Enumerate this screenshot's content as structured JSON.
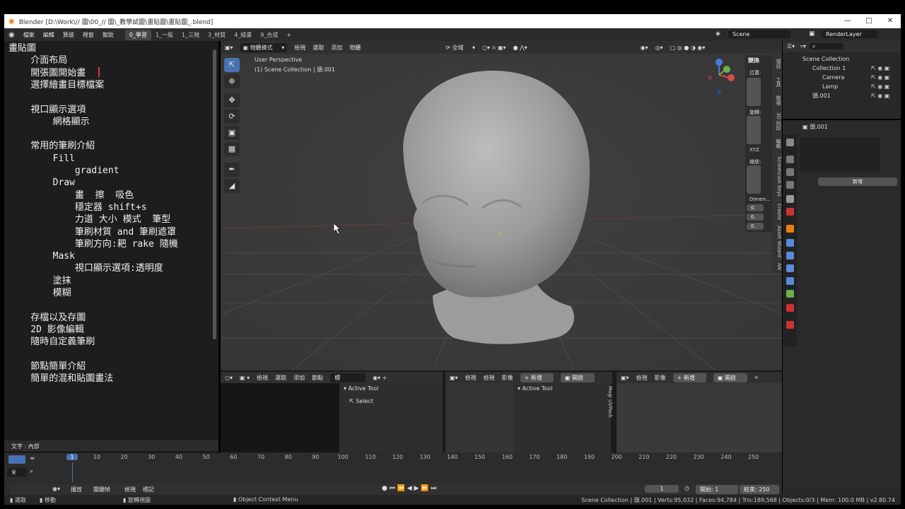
{
  "window": {
    "title": "Blender [D:\\Work\\// 圖\\00_// 圖\\_教學試圖\\畫貼圖\\畫貼圖_.blend]",
    "controls": [
      "—",
      "□",
      "✕"
    ]
  },
  "menubar": {
    "items": [
      "檔案",
      "編輯",
      "算繪",
      "視窗",
      "幫助"
    ],
    "workspaces": [
      "0_學習",
      "1_一般",
      "1_三視",
      "3_材質",
      "4_繪畫",
      "9_合成"
    ],
    "add": "+",
    "scene": "Scene",
    "renderlayer": "RenderLayer"
  },
  "textpanel": {
    "status": "文字 : 內部",
    "lines": [
      "畫貼圖",
      "    介面布局",
      "    開張圖開始畫",
      "    選擇繪畫目標檔案",
      "",
      "    視口顯示選項",
      "        網格顯示",
      "",
      "    常用的筆刷介紹",
      "        Fill",
      "            gradient",
      "        Draw",
      "            畫  擦  吸色",
      "            穩定器 shift+s",
      "            力道 大小 模式  筆型",
      "            筆刷材質 and 筆刷遮罩",
      "            筆刷方向:耙 rake 隨機",
      "        Mask",
      "            視口顯示選項:透明度",
      "        塗抹",
      "        模糊",
      "",
      "    存檔以及存圖",
      "    2D 影像編輯",
      "    隨時自定義筆刷",
      "",
      "    節點簡單介紹",
      "    簡單的混和貼圖畫法"
    ]
  },
  "viewport": {
    "mode": "物體模式",
    "menu": [
      "檢視",
      "選取",
      "添加",
      "物體"
    ],
    "orient": "全域",
    "info1": "User Perspective",
    "info2": "(1) Scene Collection | 頭.001",
    "npanel_title": "變換",
    "npanel_labels": [
      "位置:",
      "旋轉:",
      "XYZ",
      "縮放:",
      "Dimen..."
    ],
    "dim_values": [
      "0.",
      "0.",
      "0."
    ],
    "tabs": [
      "項目",
      "工具",
      "檢視",
      "3D 列印",
      "編輯",
      "Screencast Keys",
      "Create",
      "Asset Wizard",
      "AN"
    ]
  },
  "outliner": {
    "rows": [
      "Scene Collection",
      "Collection 1",
      "Camera",
      "Lamp",
      "頭.001"
    ]
  },
  "properties": {
    "object": "頭.001",
    "new": "新增"
  },
  "bottom": {
    "left_menu": [
      "檢視",
      "選取",
      "添加",
      "節點"
    ],
    "left_field": "標",
    "mid_menu": [
      "檢視",
      "檢視",
      "影像"
    ],
    "new": "新增",
    "open": "開啟",
    "right_menu": [
      "檢視",
      "影像"
    ],
    "active_tool": "Active Tool",
    "select": "Select",
    "side_tabs": [
      "Magi",
      "UVPack"
    ]
  },
  "timeline": {
    "ticks": [
      "1",
      "10",
      "20",
      "30",
      "40",
      "50",
      "60",
      "70",
      "80",
      "90",
      "100",
      "110",
      "120",
      "130",
      "140",
      "150",
      "160",
      "170",
      "180",
      "190",
      "200",
      "210",
      "220",
      "230",
      "240",
      "250"
    ],
    "menu": [
      "播放",
      "關鍵幀",
      "檢視",
      "標記"
    ],
    "frame": "1",
    "start_label": "開始:",
    "start": "1",
    "end_label": "結束:",
    "end": "250",
    "all": "全"
  },
  "status": {
    "left": [
      "選取",
      "移動",
      "旋轉視圖",
      "Object Context Menu"
    ],
    "right": "Scene Collection | 頭.001 | Verts:95,032 | Faces:94,784 | Tris:189,568 | Objects:0/3 | Mem: 100.0 MB | v2.80.74"
  }
}
